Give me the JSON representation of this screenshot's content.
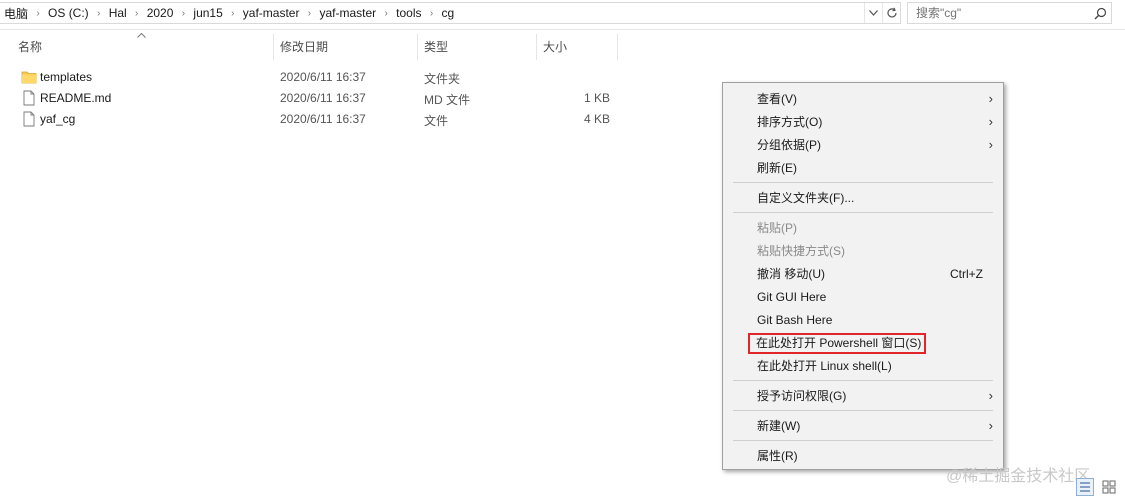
{
  "address_bar": {
    "crumbs": [
      "电脑",
      "OS (C:)",
      "Hal",
      "2020",
      "jun15",
      "yaf-master",
      "yaf-master",
      "tools",
      "cg"
    ],
    "dropdown_icon": "chevron-down-icon",
    "refresh_icon": "refresh-icon"
  },
  "search": {
    "placeholder": "搜索\"cg\"",
    "icon": "search-icon"
  },
  "columns": {
    "name": "名称",
    "date": "修改日期",
    "type": "类型",
    "size": "大小"
  },
  "files": [
    {
      "name": "templates",
      "date": "2020/6/11 16:37",
      "type": "文件夹",
      "size": "",
      "icon": "folder-icon"
    },
    {
      "name": "README.md",
      "date": "2020/6/11 16:37",
      "type": "MD 文件",
      "size": "1 KB",
      "icon": "file-icon"
    },
    {
      "name": "yaf_cg",
      "date": "2020/6/11 16:37",
      "type": "文件",
      "size": "4 KB",
      "icon": "file-icon"
    }
  ],
  "context_menu": {
    "view": "查看(V)",
    "sort_by": "排序方式(O)",
    "group_by": "分组依据(P)",
    "refresh": "刷新(E)",
    "customize": "自定义文件夹(F)...",
    "paste": "粘贴(P)",
    "paste_shortcut": "粘贴快捷方式(S)",
    "undo_move": "撤消 移动(U)",
    "undo_shortcut": "Ctrl+Z",
    "git_gui": "Git GUI Here",
    "git_bash": "Git Bash Here",
    "open_powershell": "在此处打开 Powershell 窗口(S)",
    "open_linux": "在此处打开 Linux shell(L)",
    "grant_access": "授予访问权限(G)",
    "new": "新建(W)",
    "properties": "属性(R)",
    "highlight_color": "#e0262a"
  },
  "watermark": "@稀土掘金技术社区"
}
